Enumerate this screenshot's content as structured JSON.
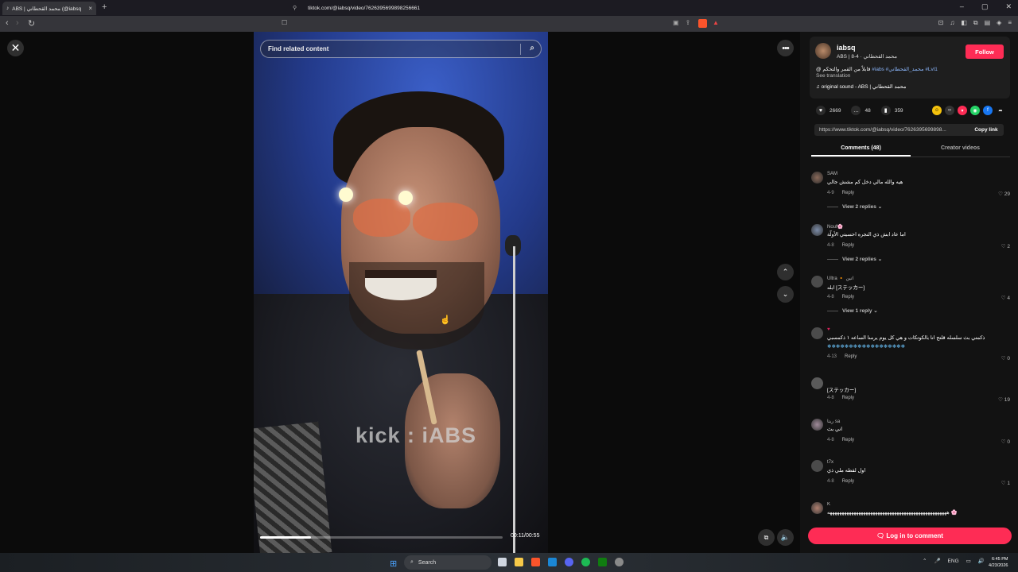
{
  "browser": {
    "tab_title": "ABS | محمد القحطاني (@iabsq",
    "tab_close": "×",
    "new_tab": "+",
    "url": "tiktok.com/@iabsq/video/7626395699898256661",
    "win_min": "–",
    "win_max": "▢",
    "win_close": "✕",
    "back": "‹",
    "forward": "›",
    "reload": "↻"
  },
  "video": {
    "search_placeholder": "Find related content",
    "watermark": "kick : iABS",
    "time": "00:11/00:55",
    "progress_fraction": 0.21
  },
  "controls": {
    "close": "✕",
    "more": "•••",
    "up": "⌃",
    "down": "⌄"
  },
  "author": {
    "username": "iabsq",
    "subtitle": "ABS | محمد القحطاني · 4-8",
    "follow": "Follow",
    "description": "@ قابلاً من القمر والتحكم",
    "tags": "#iabs #محمد_القحطاني #Lvl1",
    "see_translation": "See translation",
    "sound": "♫  original sound - ABS | محمد القحطاني"
  },
  "stats": {
    "likes": "2669",
    "comments": "48",
    "saves": "359"
  },
  "share": {
    "link": "https://www.tiktok.com/@iabsq/video/7626395699898...",
    "copy": "Copy link"
  },
  "tabs": {
    "comments": "Comments (48)",
    "creator_videos": "Creator videos"
  },
  "comments": [
    {
      "name": "SAM",
      "text": "هيه والله مالي دخل كم مشش جالي",
      "date": "4-9",
      "reply": "Reply",
      "likes": "29",
      "views": "View 2 replies"
    },
    {
      "name": "Nouf🌸",
      "text": "اما عاد ابش ذي النجره احسيتي الأولّة",
      "date": "4-8",
      "reply": "Reply",
      "likes": "2",
      "views": "View 2 replies"
    },
    {
      "name": "Ultra 🔸 اتين",
      "text": "ابله [ステッカー]",
      "date": "4-8",
      "reply": "Reply",
      "likes": "4",
      "views": "View 1 reply"
    },
    {
      "name": "♥",
      "text": "ذكمتي بث سلسله قلتج انا بالكوتكات و هي كل يوم يرمنا الساعه ١ ذكمسبي",
      "text2": "❄❄❄❄❄❄❄❄❄❄❄❄❄❄❄❄❄❄",
      "date": "4-13",
      "reply": "Reply",
      "likes": "0",
      "views": ""
    },
    {
      "name": "",
      "text": "[ステッカー]",
      "date": "4-8",
      "reply": "Reply",
      "likes": "19",
      "views": ""
    },
    {
      "name": "ريتا sa",
      "text": "اني بث",
      "date": "4-8",
      "reply": "Reply",
      "likes": "0",
      "views": ""
    },
    {
      "name": "t7x",
      "text": "اول لقطه ملي ذي",
      "date": "4-8",
      "reply": "Reply",
      "likes": "1",
      "views": ""
    },
    {
      "name": "K",
      "text": "ههههههههههههههههههههههههههههههههههههههههههههههههههه 🌸",
      "date": "",
      "reply": "",
      "likes": "",
      "views": ""
    }
  ],
  "login": "🗨 Log in to comment",
  "taskbar": {
    "search": "Search",
    "lang": "ENG",
    "time": "6:45 PM",
    "date": "4/23/2026"
  }
}
